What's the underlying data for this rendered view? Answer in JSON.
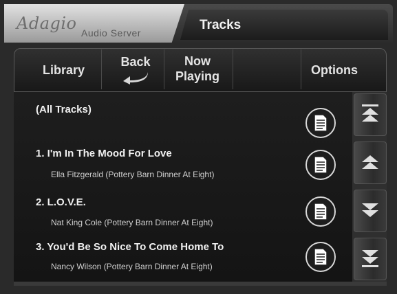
{
  "header": {
    "logo_script": "Adagio",
    "logo_sub": "Audio Server",
    "page_title": "Tracks"
  },
  "toolbar": {
    "library_label": "Library",
    "back_label": "Back",
    "now_playing_line1": "Now",
    "now_playing_line2": "Playing",
    "options_label": "Options"
  },
  "list": {
    "all_tracks_label": "(All Tracks)",
    "tracks": [
      {
        "title": "1. I'm In The Mood For Love",
        "subtitle": "Ella Fitzgerald (Pottery Barn Dinner At Eight)"
      },
      {
        "title": "2. L.O.V.E.",
        "subtitle": "Nat King Cole (Pottery Barn Dinner At Eight)"
      },
      {
        "title": "3. You'd Be So Nice To Come Home To",
        "subtitle": "Nancy Wilson (Pottery Barn Dinner At Eight)"
      }
    ]
  },
  "icons": {
    "back": "back-arrow-icon",
    "details": "document-icon",
    "scroll_top": "page-up-icon",
    "scroll_up": "arrow-up-icon",
    "scroll_down": "arrow-down-icon",
    "scroll_bottom": "page-down-icon"
  },
  "colors": {
    "background": "#2a2a2a",
    "text": "#f0f0f0",
    "logo_bg": "#d0d0d0"
  }
}
